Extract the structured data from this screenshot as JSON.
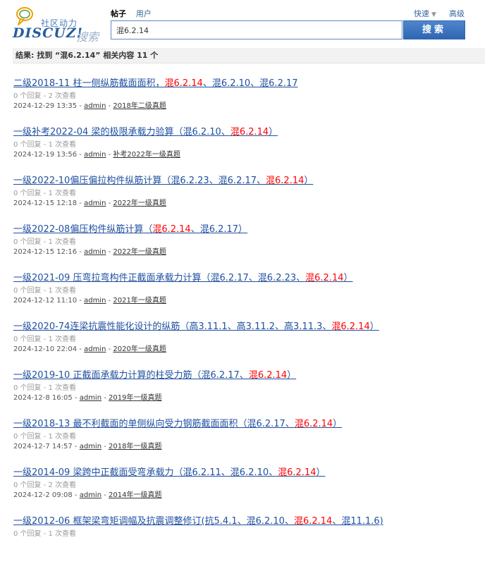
{
  "logo": {
    "community_text": "社区动力",
    "brand": "DISCUZ!",
    "search_text": "搜索"
  },
  "search": {
    "tabs": [
      {
        "label": "帖子",
        "active": true
      },
      {
        "label": "用户",
        "active": false
      }
    ],
    "quick_label": "快速",
    "advanced_label": "高级",
    "query": "混6.2.14",
    "button_label": "搜索"
  },
  "summary": "结果: 找到 “混6.2.14” 相关内容 11 个",
  "results": [
    {
      "title_pre": "二级2018-11 柱一侧纵筋截面面积，",
      "title_hl": "混6.2.14",
      "title_post": "、混6.2.10、混6.2.17",
      "stats": "0 个回复 - 2 次查看",
      "date": "2024-12-29 13:35",
      "author": "admin",
      "forum": "2018年二级真题"
    },
    {
      "title_pre": "一级补考2022-04 梁的极限承载力验算（混6.2.10、",
      "title_hl": "混6.2.14",
      "title_post": "）",
      "stats": "0 个回复 - 1 次查看",
      "date": "2024-12-19 13:56",
      "author": "admin",
      "forum": "补考2022年一级真题"
    },
    {
      "title_pre": "一级2022-10偏压偏拉构件纵筋计算（混6.2.23、混6.2.17、",
      "title_hl": "混6.2.14",
      "title_post": "）",
      "stats": "0 个回复 - 1 次查看",
      "date": "2024-12-15 12:18",
      "author": "admin",
      "forum": "2022年一级真题"
    },
    {
      "title_pre": "一级2022-08偏压构件纵筋计算（",
      "title_hl": "混6.2.14",
      "title_post": "、混6.2.17）",
      "stats": "0 个回复 - 1 次查看",
      "date": "2024-12-15 12:16",
      "author": "admin",
      "forum": "2022年一级真题"
    },
    {
      "title_pre": "一级2021-09 压弯拉弯构件正截面承载力计算（混6.2.17、混6.2.23、",
      "title_hl": "混6.2.14",
      "title_post": "）",
      "stats": "0 个回复 - 1 次查看",
      "date": "2024-12-12 11:10",
      "author": "admin",
      "forum": "2021年一级真题"
    },
    {
      "title_pre": "一级2020-74连梁抗震性能化设计的纵筋（高3.11.1、高3.11.2、高3.11.3、",
      "title_hl": "混6.2.14",
      "title_post": "）",
      "stats": "0 个回复 - 1 次查看",
      "date": "2024-12-10 22:04",
      "author": "admin",
      "forum": "2020年一级真题"
    },
    {
      "title_pre": "一级2019-10 正截面承载力计算的柱受力筋（混6.2.17、",
      "title_hl": "混6.2.14",
      "title_post": "）",
      "stats": "0 个回复 - 1 次查看",
      "date": "2024-12-8 16:05",
      "author": "admin",
      "forum": "2019年一级真题"
    },
    {
      "title_pre": "一级2018-13 最不利截面的单侧纵向受力钢筋截面面积（混6.2.17、",
      "title_hl": "混6.2.14",
      "title_post": "）",
      "stats": "0 个回复 - 1 次查看",
      "date": "2024-12-7 14:57",
      "author": "admin",
      "forum": "2018年一级真题"
    },
    {
      "title_pre": "一级2014-09 梁跨中正截面受弯承载力（混6.2.11、混6.2.10、",
      "title_hl": "混6.2.14",
      "title_post": "）",
      "stats": "0 个回复 - 2 次查看",
      "date": "2024-12-2 09:08",
      "author": "admin",
      "forum": "2014年一级真题"
    },
    {
      "title_pre": "一级2012-06 框架梁弯矩调幅及抗震调整修订(抗5.4.1、混6.2.10、",
      "title_hl": "混6.2.14",
      "title_post": "、混11.1.6)",
      "stats": "0 个回复 - 1 次查看",
      "date": "",
      "author": "",
      "forum": ""
    }
  ]
}
